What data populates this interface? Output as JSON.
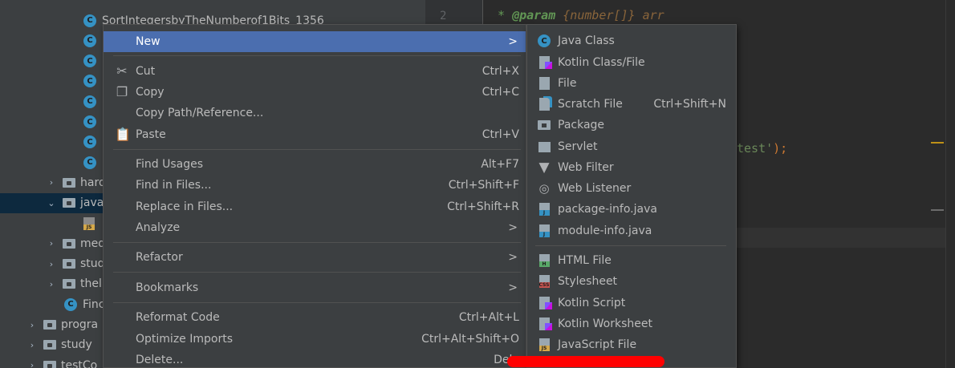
{
  "tree": {
    "rows": [
      {
        "kind": "class",
        "label": "SortIntegersbyTheNumberof1Bits_1356"
      },
      {
        "kind": "class",
        "label": ""
      },
      {
        "kind": "class",
        "label": ""
      },
      {
        "kind": "class",
        "label": ""
      },
      {
        "kind": "class",
        "label": ""
      },
      {
        "kind": "class",
        "label": ""
      },
      {
        "kind": "class",
        "label": ""
      },
      {
        "kind": "class",
        "label": ""
      },
      {
        "kind": "folder",
        "label": "hard"
      },
      {
        "kind": "folder-open",
        "label": "java"
      },
      {
        "kind": "js",
        "label": ""
      },
      {
        "kind": "folder",
        "label": "med"
      },
      {
        "kind": "folder",
        "label": "stud"
      },
      {
        "kind": "folder",
        "label": "thel"
      },
      {
        "kind": "class",
        "label": "Finc"
      },
      {
        "kind": "folder",
        "label": "progra"
      },
      {
        "kind": "folder",
        "label": "study"
      },
      {
        "kind": "folder",
        "label": "testCo"
      }
    ]
  },
  "editor": {
    "line_number": "2",
    "comment_star": "*",
    "param_tag": "@param",
    "param_type": "{number[]}",
    "param_name": "arr",
    "string_fragment": "test'",
    "string_close": ");"
  },
  "menu": {
    "new": "New",
    "cut": "Cut",
    "cut_sc": "Ctrl+X",
    "copy": "Copy",
    "copy_sc": "Ctrl+C",
    "copy_path": "Copy Path/Reference...",
    "paste": "Paste",
    "paste_sc": "Ctrl+V",
    "find_usages": "Find Usages",
    "find_usages_sc": "Alt+F7",
    "find_in_files": "Find in Files...",
    "find_in_files_sc": "Ctrl+Shift+F",
    "replace_in_files": "Replace in Files...",
    "replace_in_files_sc": "Ctrl+Shift+R",
    "analyze": "Analyze",
    "refactor": "Refactor",
    "bookmarks": "Bookmarks",
    "reformat": "Reformat Code",
    "reformat_sc": "Ctrl+Alt+L",
    "optimize": "Optimize Imports",
    "optimize_sc": "Ctrl+Alt+Shift+O",
    "delete": "Delete...",
    "delete_sc": "Dele",
    "submenu_arrow": ">"
  },
  "submenu": {
    "java_class": "Java Class",
    "kotlin_class": "Kotlin Class/File",
    "file": "File",
    "scratch": "Scratch File",
    "scratch_sc": "Ctrl+Shift+N",
    "package": "Package",
    "servlet": "Servlet",
    "web_filter": "Web Filter",
    "web_listener": "Web Listener",
    "package_info": "package-info.java",
    "module_info": "module-info.java",
    "html_file": "HTML File",
    "stylesheet": "Stylesheet",
    "kotlin_script": "Kotlin Script",
    "kotlin_worksheet": "Kotlin Worksheet",
    "javascript_file": "JavaScript File"
  },
  "colors": {
    "menu_bg": "#3c3f41",
    "highlight": "#4b6eaf",
    "annotation": "#ff0000"
  }
}
